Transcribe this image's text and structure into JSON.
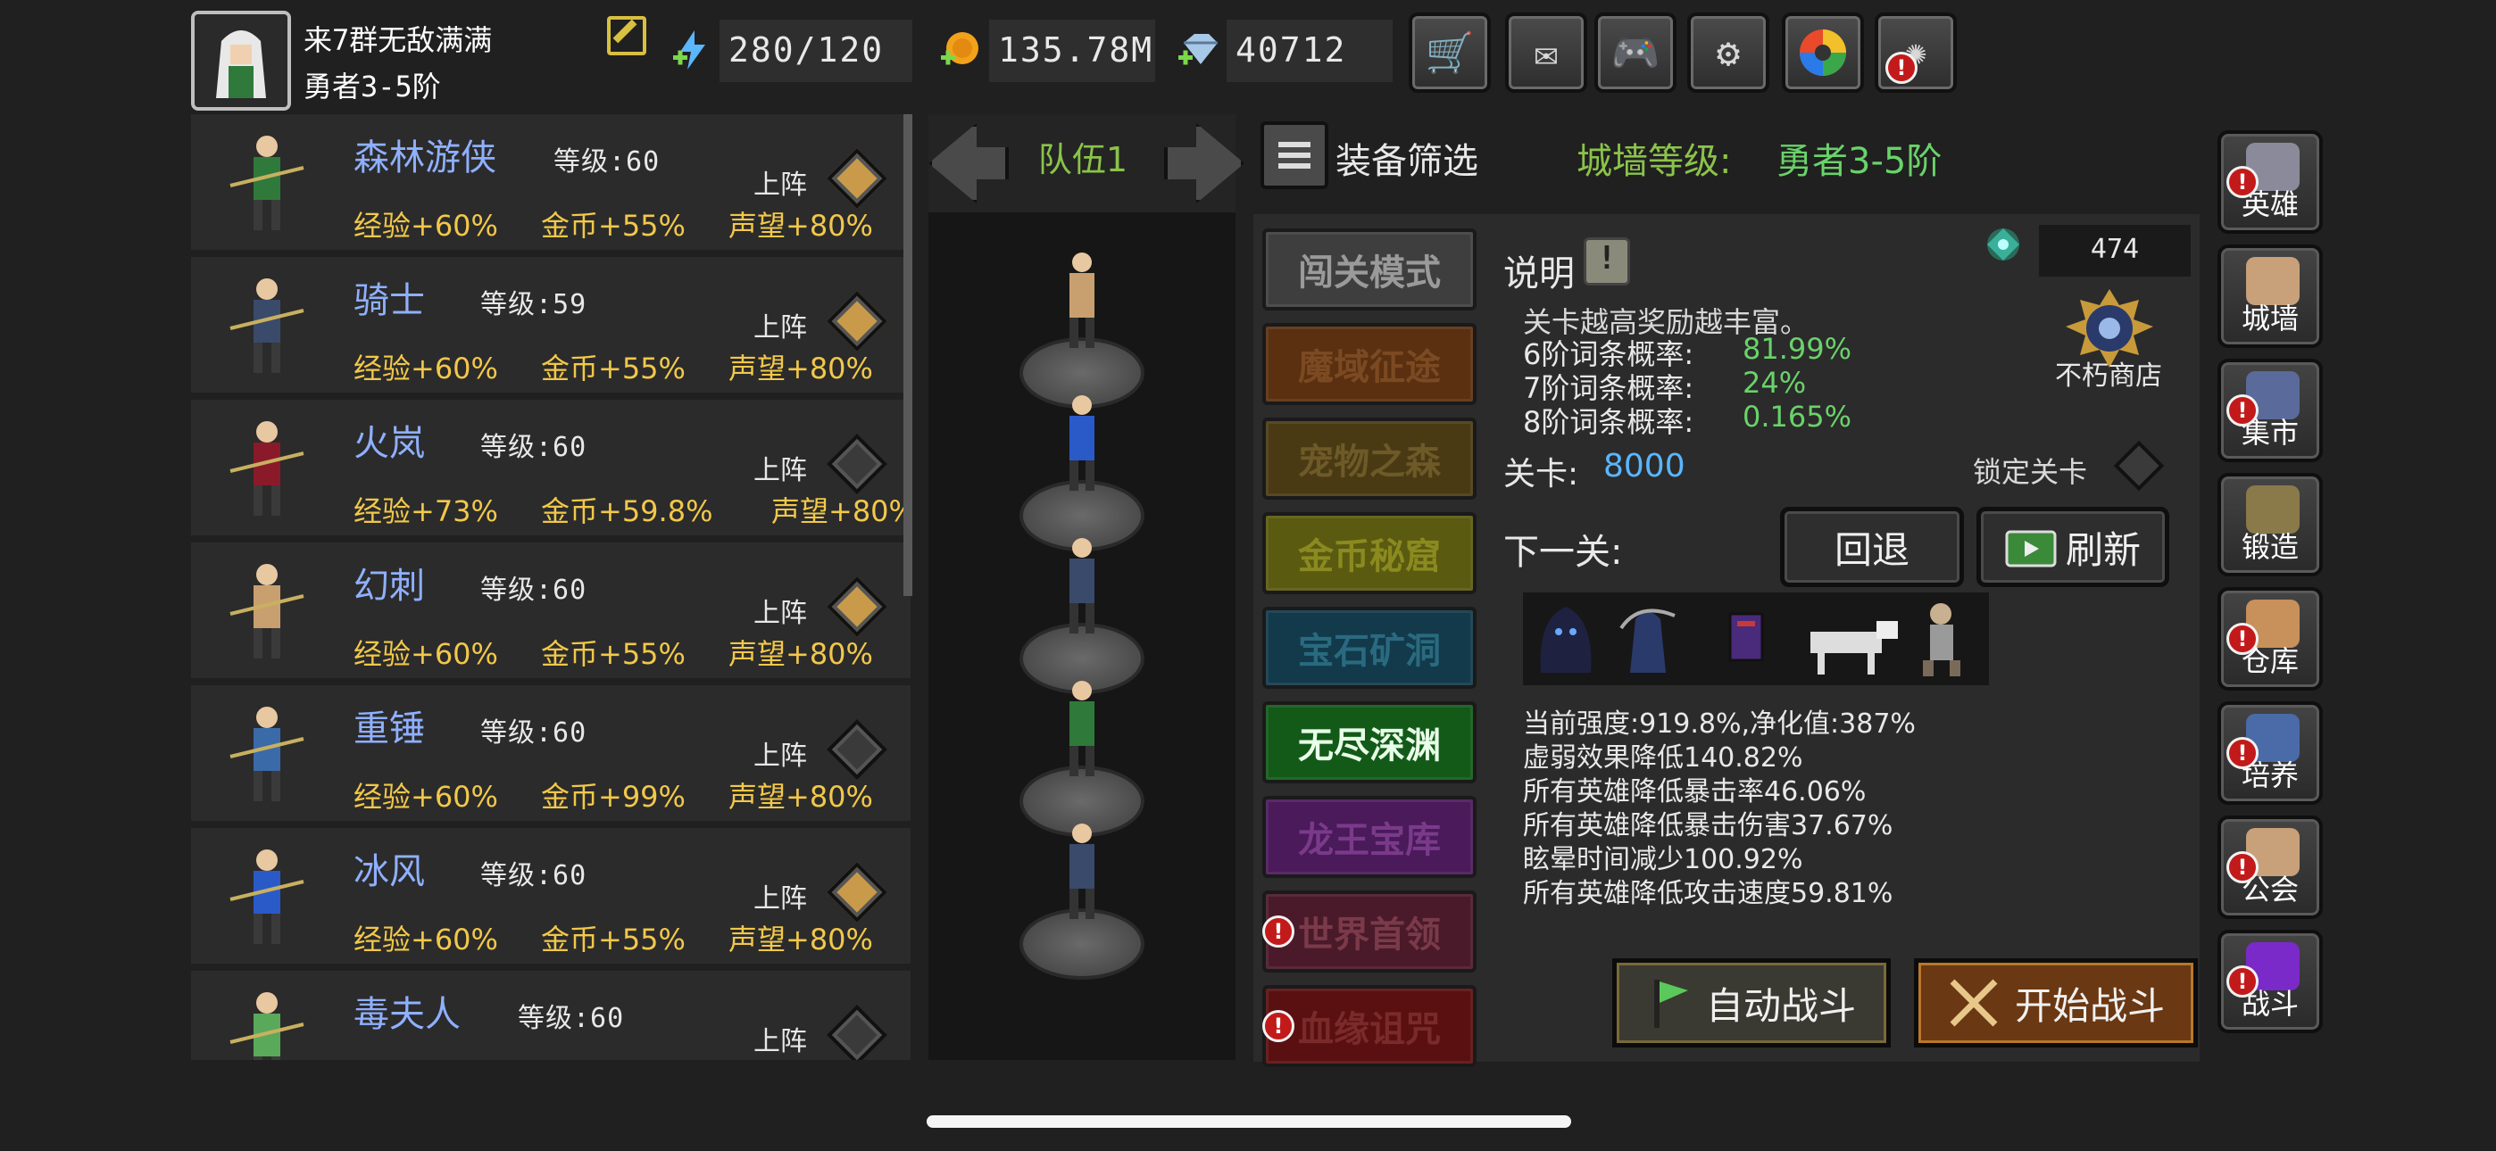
{
  "player": {
    "name": "来7群无敌满满",
    "rank": "勇者3-5阶"
  },
  "resources": {
    "energy": "280/120",
    "gold": "135.78M",
    "gems": "40712"
  },
  "toolbar": [
    "cart-icon",
    "mail-icon",
    "gamepad-icon",
    "gear-icon",
    "color-wheel-icon",
    "fireworks-icon"
  ],
  "heroes": [
    {
      "name": "森林游侠",
      "level": "等级:60",
      "exp": "经验+60%",
      "gold": "金币+55%",
      "fame": "声望+80%",
      "deploy": "上阵",
      "deployed": true
    },
    {
      "name": "骑士",
      "level": "等级:59",
      "exp": "经验+60%",
      "gold": "金币+55%",
      "fame": "声望+80%",
      "deploy": "上阵",
      "deployed": true
    },
    {
      "name": "火岚",
      "level": "等级:60",
      "exp": "经验+73%",
      "gold": "金币+59.8%",
      "fame": "声望+80%",
      "deploy": "上阵",
      "deployed": false
    },
    {
      "name": "幻刺",
      "level": "等级:60",
      "exp": "经验+60%",
      "gold": "金币+55%",
      "fame": "声望+80%",
      "deploy": "上阵",
      "deployed": true
    },
    {
      "name": "重锤",
      "level": "等级:60",
      "exp": "经验+60%",
      "gold": "金币+99%",
      "fame": "声望+80%",
      "deploy": "上阵",
      "deployed": false
    },
    {
      "name": "冰风",
      "level": "等级:60",
      "exp": "经验+60%",
      "gold": "金币+55%",
      "fame": "声望+80%",
      "deploy": "上阵",
      "deployed": true
    },
    {
      "name": "毒夫人",
      "level": "等级:60",
      "exp": "",
      "gold": "",
      "fame": "",
      "deploy": "上阵",
      "deployed": false
    }
  ],
  "team": {
    "title": "队伍1"
  },
  "filter": {
    "label": "装备筛选",
    "wall_label": "城墙等级:",
    "wall_value": "勇者3-5阶"
  },
  "modes": [
    {
      "label": "闯关模式",
      "bg": "#3e3e3e",
      "fg": "#9a9a9a",
      "alert": false
    },
    {
      "label": "魔域征途",
      "bg": "#5a3010",
      "fg": "#7b4a22",
      "alert": false
    },
    {
      "label": "宠物之森",
      "bg": "#4a3a14",
      "fg": "#6e5a28",
      "alert": false
    },
    {
      "label": "金币秘窟",
      "bg": "#5a5a10",
      "fg": "#8a8a20",
      "alert": false
    },
    {
      "label": "宝石矿洞",
      "bg": "#123a4a",
      "fg": "#2a6a80",
      "alert": false
    },
    {
      "label": "无尽深渊",
      "bg": "#135a18",
      "fg": "#e8ffe8",
      "alert": false
    },
    {
      "label": "龙王宝库",
      "bg": "#4a1a5a",
      "fg": "#7a3a8a",
      "alert": false
    },
    {
      "label": "世界首领",
      "bg": "#4a1a2a",
      "fg": "#7a3a4a",
      "alert": true
    },
    {
      "label": "血缘诅咒",
      "bg": "#5a1010",
      "fg": "#7a2a2a",
      "alert": true
    }
  ],
  "info": {
    "title": "说明",
    "line1": "关卡越高奖励越丰富。",
    "p6_label": "6阶词条概率:",
    "p6_value": "81.99%",
    "p7_label": "7阶词条概率:",
    "p7_value": "24%",
    "p8_label": "8阶词条概率:",
    "p8_value": "0.165%",
    "stage_label": "关卡:",
    "stage_value": "8000",
    "lock_label": "锁定关卡",
    "next_label": "下一关:",
    "back_label": "回退",
    "refresh_label": "刷新",
    "currency": "474",
    "shop_label": "不朽商店"
  },
  "stats": [
    "当前强度:919.8%,净化值:387%",
    "虚弱效果降低140.82%",
    "所有英雄降低暴击率46.06%",
    "所有英雄降低暴击伤害37.67%",
    "眩晕时间减少100.92%",
    "所有英雄降低攻击速度59.81%"
  ],
  "battle": {
    "auto_label": "自动战斗",
    "start_label": "开始战斗"
  },
  "sidebar": [
    {
      "label": "英雄",
      "icon": "helmet-icon",
      "alert": true
    },
    {
      "label": "城墙",
      "icon": "castle-wall-icon",
      "alert": false
    },
    {
      "label": "集市",
      "icon": "market-icon",
      "alert": true
    },
    {
      "label": "锻造",
      "icon": "anvil-icon",
      "alert": false
    },
    {
      "label": "仓库",
      "icon": "warehouse-icon",
      "alert": true
    },
    {
      "label": "培养",
      "icon": "goblet-icon",
      "alert": true
    },
    {
      "label": "公会",
      "icon": "guild-icon",
      "alert": true
    },
    {
      "label": "战斗",
      "icon": "portal-icon",
      "alert": true
    }
  ]
}
